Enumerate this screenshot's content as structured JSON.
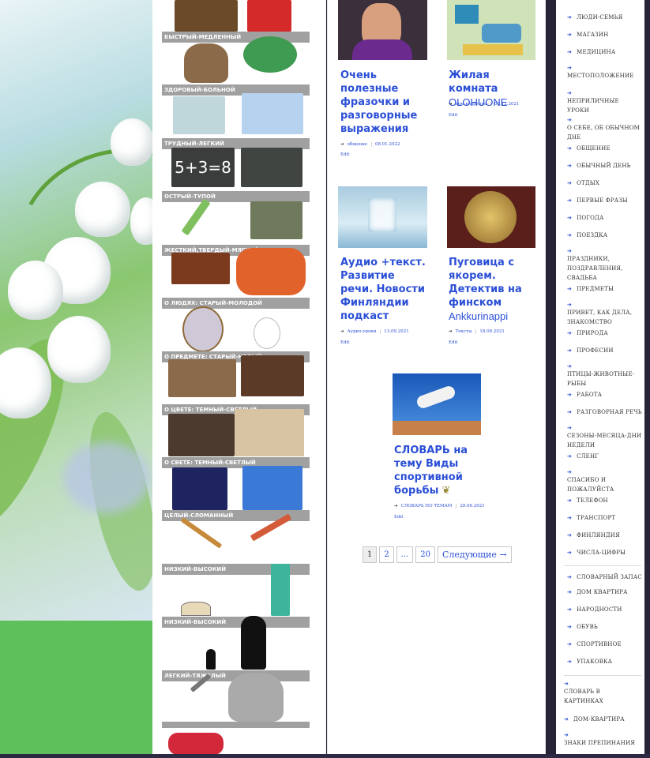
{
  "left_pairs": [
    {
      "label": "Быстрый-медленный"
    },
    {
      "label": "Здоровый-больной"
    },
    {
      "label": "Трудный-легкий"
    },
    {
      "label": "Острый-тупой"
    },
    {
      "label": "Жесткий,твердый-мягкий"
    },
    {
      "label": "О людях: старый-молодой"
    },
    {
      "label": "О предмете: старый-новый"
    },
    {
      "label": "О цвете: темный-светлый"
    },
    {
      "label": "О свете: темный-светлый"
    },
    {
      "label": "Целый-сломанный"
    },
    {
      "label": "Низкий-высокий"
    },
    {
      "label": "Низкий-высокий"
    },
    {
      "label": "Легкий-тяжелый"
    }
  ],
  "posts": [
    {
      "title": "Очень полезные фразочки и разговорные выражения",
      "subtitle": "",
      "category": "общение",
      "date": "08.01.2022",
      "edit": "Edit"
    },
    {
      "title": "Жилая комната",
      "subtitle": "OLOHUONE",
      "category": "дом квартира",
      "date": "03.12.2021",
      "edit": "Edit"
    },
    {
      "title": "Аудио +текст. Развитие речи. Новости Финляндии подкаст",
      "subtitle": "",
      "category": "Аудио-уроки",
      "date": "13.09.2021",
      "edit": "Edit"
    },
    {
      "title": "Пуговица с якорем. Детектив на финском",
      "subtitle": "Ankkurinappi",
      "category": "Тексты",
      "date": "18.08.2021",
      "edit": "Edit"
    },
    {
      "title": "СЛОВАРЬ на тему Виды спортивной борьбы",
      "subtitle": "",
      "category": "СЛОВАРЬ ПО ТЕМАМ",
      "date": "29.06.2021",
      "edit": "Edit"
    }
  ],
  "pagination": {
    "pages": [
      "1",
      "2",
      "...",
      "20"
    ],
    "next": "Следующие →",
    "current": "1"
  },
  "sidebar": {
    "items_a": [
      "люди-семья",
      "магазин",
      "медицина",
      "местоположение",
      "неприличные уроки",
      "о себе, об обычном дне",
      "общение",
      "обычный день",
      "отдых",
      "первые фразы",
      "погода",
      "поездка",
      "праздники, поздравления, свадьба",
      "предметы",
      "привет, как дела, знакомство",
      "природа",
      "професии",
      "птицы-животные-рыбы",
      "работа",
      "разговорная речь",
      "сезоны-месяца-дни недели",
      "сленг",
      "спасибо и пожалуйста",
      "телефон",
      "транспорт",
      "Финляндия",
      "числа-цифры"
    ],
    "items_b": [
      "Словарный запас",
      "дом квартира",
      "народности",
      "обувь",
      "спортивное",
      "упаковка"
    ],
    "items_c": [
      "Словарь в картинках",
      "Дом-квартира",
      "знаки препинания"
    ],
    "arrow": "➔"
  },
  "colors": {
    "link": "#2b4fd6",
    "label_bg": "#a0a0a0",
    "page_bg": "#262436"
  }
}
